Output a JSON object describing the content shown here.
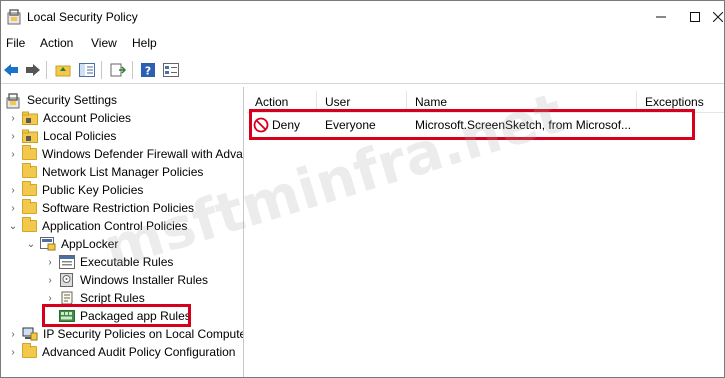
{
  "window": {
    "title": "Local Security Policy"
  },
  "menu": [
    "File",
    "Action",
    "View",
    "Help"
  ],
  "tree": {
    "root": "Security Settings",
    "items": [
      "Account Policies",
      "Local Policies",
      "Windows Defender Firewall with Adva",
      "Network List Manager Policies",
      "Public Key Policies",
      "Software Restriction Policies",
      "Application Control Policies",
      "AppLocker",
      "Executable Rules",
      "Windows Installer Rules",
      "Script Rules",
      "Packaged app Rules",
      "IP Security Policies on Local Compute",
      "Advanced Audit Policy Configuration"
    ]
  },
  "list": {
    "columns": [
      "Action",
      "User",
      "Name",
      "Exceptions"
    ],
    "rows": [
      {
        "action": "Deny",
        "user": "Everyone",
        "name": "Microsoft.ScreenSketch, from Microsof...",
        "exceptions": ""
      }
    ]
  },
  "watermark": "msftminfra.net",
  "colors": {
    "highlight": "#d6001c",
    "folder": "#f2c94c",
    "deny": "#d6001c"
  }
}
